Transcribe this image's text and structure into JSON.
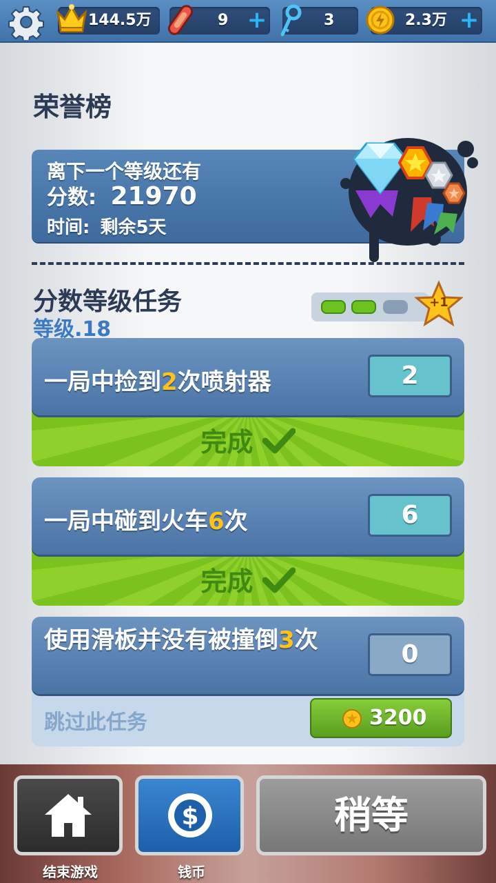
{
  "topbar": {
    "score": "144.5万",
    "boards": "9",
    "keys": "3",
    "coins": "2.3万",
    "plus": "+"
  },
  "page": {
    "title": "荣誉榜"
  },
  "next_level": {
    "line1": "离下一个等级还有",
    "score_label": "分数:",
    "score_value": "21970",
    "time_label": "时间:",
    "time_value": "剩余5天"
  },
  "missions_section": {
    "title": "分数等级任务",
    "level": "等级.18",
    "progress_filled": 2,
    "progress_total": 3,
    "star_bonus": "+1"
  },
  "missions": [
    {
      "pre": "一局中捡到",
      "num": "2",
      "post": "次喷射器",
      "count": "2",
      "status": "完成"
    },
    {
      "pre": "一局中碰到火车",
      "num": "6",
      "post": "次",
      "count": "6",
      "status": "完成"
    },
    {
      "pre": "使用滑板并没有被撞倒",
      "num": "3",
      "post": "次",
      "count": "0",
      "skip_label": "跳过此任务",
      "skip_cost": "3200"
    }
  ],
  "bottom": {
    "quit_label": "结束游戏",
    "coins_label": "钱币",
    "wait_label": "稍等"
  },
  "colors": {
    "accent_blue": "#4a74a6",
    "complete_green": "#7cc21f",
    "highlight_yellow": "#ffc21a"
  }
}
